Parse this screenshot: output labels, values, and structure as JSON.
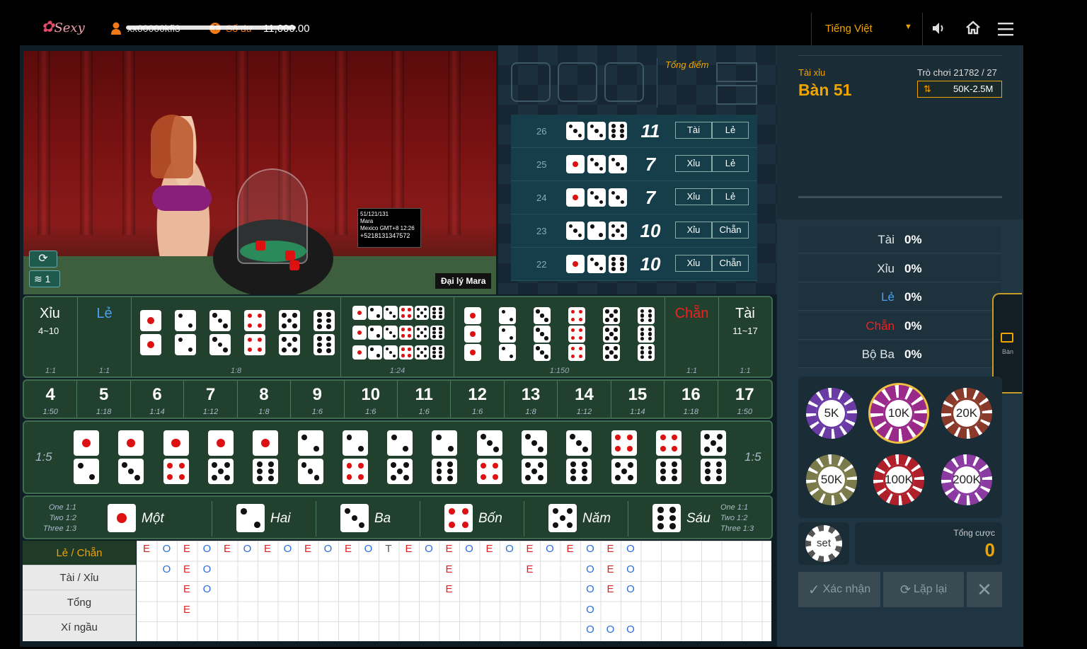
{
  "header": {
    "brand": "Sexy",
    "user_id": "xx00000kfi3",
    "balance_label": "Số dư",
    "balance_value": "11,000.00",
    "language": "Tiếng Việt"
  },
  "table": {
    "game_type": "Tài xỉu",
    "name": "Bàn 51",
    "round_label": "Trò chơi 21782 / 27",
    "limit": "50K-2.5M",
    "side_tab": "Bàn"
  },
  "video": {
    "dealer_label": "Đại lý Mara",
    "sign_line1": "51/121/131",
    "sign_line2": "Mara",
    "sign_line3": "Mexico GMT+8 12:26",
    "sign_line4": "+5218131347572",
    "network_level": "1"
  },
  "result_panel": {
    "total_label": "Tổng điểm"
  },
  "history": [
    {
      "round": "26",
      "dice": [
        3,
        3,
        6
      ],
      "sum": "11",
      "big": "Tài",
      "odd": "Lẻ"
    },
    {
      "round": "25",
      "dice": [
        1,
        3,
        3
      ],
      "sum": "7",
      "big": "Xỉu",
      "odd": "Lẻ"
    },
    {
      "round": "24",
      "dice": [
        1,
        3,
        3
      ],
      "sum": "7",
      "big": "Xỉu",
      "odd": "Lẻ"
    },
    {
      "round": "23",
      "dice": [
        3,
        2,
        5
      ],
      "sum": "10",
      "big": "Xỉu",
      "odd": "Chẵn"
    },
    {
      "round": "22",
      "dice": [
        1,
        3,
        6
      ],
      "sum": "10",
      "big": "Xỉu",
      "odd": "Chẵn"
    }
  ],
  "board": {
    "small": {
      "label": "Xỉu",
      "range": "4~10",
      "odds": "1:1"
    },
    "odd": {
      "label": "Lẻ",
      "odds": "1:1"
    },
    "double_odds": "1:8",
    "any_triple_odds": "1:24",
    "triple_odds": "1:150",
    "even": {
      "label": "Chẵn",
      "odds": "1:1"
    },
    "big": {
      "label": "Tài",
      "range": "11~17",
      "odds": "1:1"
    },
    "sums": [
      {
        "n": "4",
        "o": "1:50"
      },
      {
        "n": "5",
        "o": "1:18"
      },
      {
        "n": "6",
        "o": "1:14"
      },
      {
        "n": "7",
        "o": "1:12"
      },
      {
        "n": "8",
        "o": "1:8"
      },
      {
        "n": "9",
        "o": "1:6"
      },
      {
        "n": "10",
        "o": "1:6"
      },
      {
        "n": "11",
        "o": "1:6"
      },
      {
        "n": "12",
        "o": "1:6"
      },
      {
        "n": "13",
        "o": "1:8"
      },
      {
        "n": "14",
        "o": "1:12"
      },
      {
        "n": "15",
        "o": "1:14"
      },
      {
        "n": "16",
        "o": "1:18"
      },
      {
        "n": "17",
        "o": "1:50"
      }
    ],
    "pair_odds": "1:5",
    "faces": [
      "Một",
      "Hai",
      "Ba",
      "Bốn",
      "Năm",
      "Sáu"
    ],
    "face_odds": {
      "one": "One 1:1",
      "two": "Two 1:2",
      "three": "Three 1:3"
    }
  },
  "road": {
    "tabs": [
      "Lẻ / Chẵn",
      "Tài / Xỉu",
      "Tổng",
      "Xí ngầu"
    ],
    "row1": [
      "E",
      "O",
      "E",
      "O",
      "E",
      "O",
      "E",
      "O",
      "E",
      "O",
      "E",
      "O",
      "T",
      "E",
      "O",
      "E",
      "O",
      "E",
      "O",
      "E",
      "O",
      "E",
      "O",
      "E",
      "O"
    ],
    "row2": [
      "",
      "O",
      "E",
      "O",
      "",
      "",
      "",
      "",
      "",
      "",
      "",
      "",
      "",
      "",
      "",
      "E",
      "",
      "",
      "",
      "E",
      "",
      "",
      "O",
      "E",
      "O"
    ],
    "row3": [
      "",
      "",
      "E",
      "O",
      "",
      "",
      "",
      "",
      "",
      "",
      "",
      "",
      "",
      "",
      "",
      "E",
      "",
      "",
      "",
      "",
      "",
      "",
      "O",
      "E",
      "O"
    ],
    "row4": [
      "",
      "",
      "E",
      "",
      "",
      "",
      "",
      "",
      "",
      "",
      "",
      "",
      "",
      "",
      "",
      "",
      "",
      "",
      "",
      "",
      "",
      "",
      "O",
      "",
      ""
    ],
    "row5": [
      "",
      "",
      "",
      "",
      "",
      "",
      "",
      "",
      "",
      "",
      "",
      "",
      "",
      "",
      "",
      "",
      "",
      "",
      "",
      "",
      "",
      "",
      "O",
      "O",
      "O"
    ]
  },
  "stats": [
    {
      "label": "Tài",
      "value": "0%",
      "color": "#dfe6ea"
    },
    {
      "label": "Xỉu",
      "value": "0%",
      "color": "#dfe6ea"
    },
    {
      "label": "Lẻ",
      "value": "0%",
      "color": "#4a9ff0"
    },
    {
      "label": "Chẵn",
      "value": "0%",
      "color": "#e22"
    },
    {
      "label": "Bộ Ba",
      "value": "0%",
      "color": "#dfe6ea"
    }
  ],
  "chips": [
    {
      "label": "5K",
      "color": "#6a3aa5"
    },
    {
      "label": "10K",
      "color": "#9a2a8a"
    },
    {
      "label": "20K",
      "color": "#8a3a2a"
    },
    {
      "label": "50K",
      "color": "#7a7a4a"
    },
    {
      "label": "100K",
      "color": "#b0202a"
    },
    {
      "label": "200K",
      "color": "#8a3aa0"
    }
  ],
  "set_label": "set",
  "total_bet": {
    "label": "Tổng cược",
    "value": "0"
  },
  "actions": {
    "confirm": "Xác nhận",
    "repeat": "Lặp lại"
  },
  "colors": {
    "accent": "#f0a400",
    "felt": "#21402d",
    "red": "#e22",
    "blue": "#4a9ff0"
  }
}
